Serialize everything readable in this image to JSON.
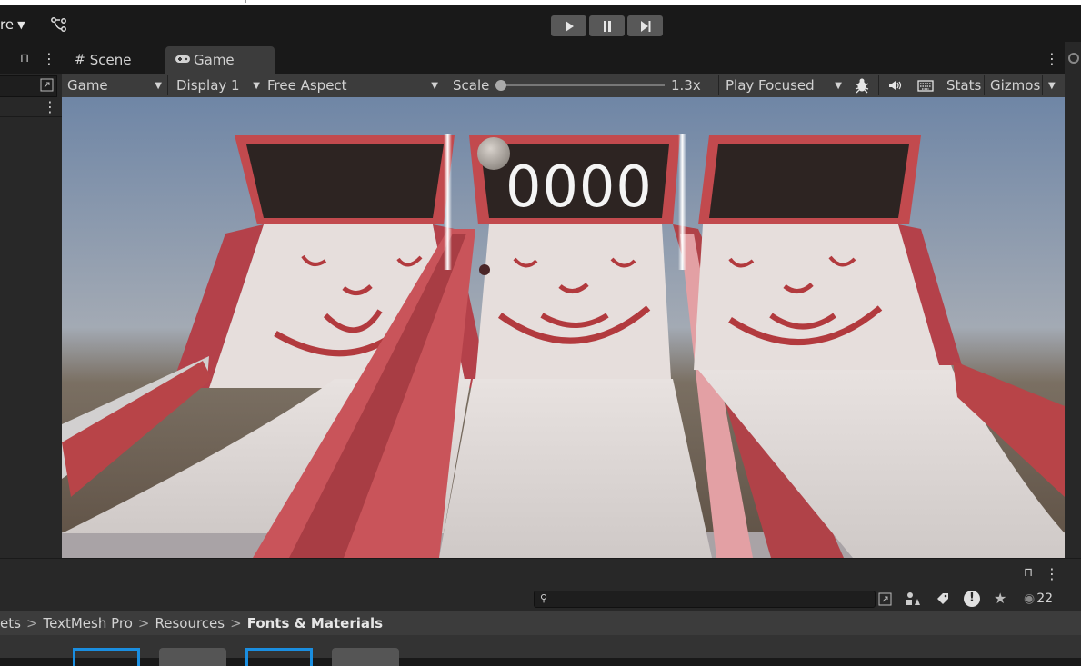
{
  "toolbar": {
    "menu_label": "re",
    "play_label": "play-icon",
    "pause_label": "pause-icon",
    "step_label": "step-icon"
  },
  "tabs": [
    {
      "label": "Scene",
      "icon": "grid-icon"
    },
    {
      "label": "Game",
      "icon": "gamepad-icon"
    }
  ],
  "game_toolbar": {
    "view_select": "Game",
    "display_select": "Display 1",
    "aspect_select": "Free Aspect",
    "scale_label": "Scale",
    "scale_value": "1.3x",
    "scale_fraction": 0.0,
    "play_mode_select": "Play Focused",
    "stats_label": "Stats",
    "gizmos_label": "Gizmos"
  },
  "game_view": {
    "score_text": "0000"
  },
  "project": {
    "breadcrumb": [
      "ets",
      "TextMesh Pro",
      "Resources",
      "Fonts & Materials"
    ],
    "visible_count": "22",
    "search_placeholder": ""
  },
  "colors": {
    "accent": "#4a9eff",
    "machine_red": "#c0484c",
    "lane_white": "#dcd6d4",
    "sky": "#8a9cb4"
  }
}
